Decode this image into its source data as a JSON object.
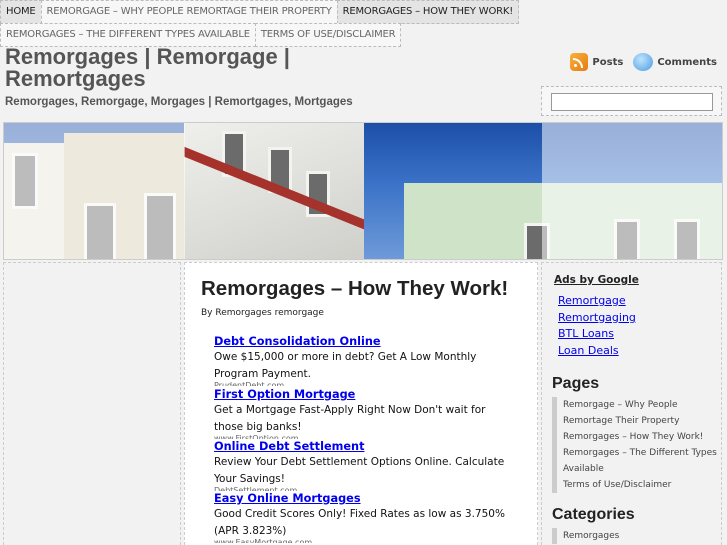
{
  "nav": {
    "row1": [
      "HOME",
      "REMORGAGE – WHY PEOPLE REMORTAGE THEIR PROPERTY",
      "REMORGAGES – HOW THEY WORK!"
    ],
    "row2": [
      "REMORGAGES – THE DIFFERENT TYPES AVAILABLE",
      "TERMS OF USE/DISCLAIMER"
    ]
  },
  "header": {
    "title": "Remorgages | Remorgage | Remortgages",
    "description": "Remorgages, Remorgage, Morgages | Remortgages, Mortgages",
    "posts_label": "Posts",
    "comments_label": "Comments"
  },
  "colors": {
    "link": "#0000ee",
    "rss": "#f08a1c",
    "sky": "#2e63b8"
  },
  "post": {
    "title": "Remorgages – How They Work!",
    "byline": "By Remorgages remorgage",
    "ads": [
      {
        "title": "Debt Consolidation Online",
        "desc": "Owe $15,000 or more in debt? Get A Low Monthly Program Payment.",
        "url": "PrudentDebt.com"
      },
      {
        "title": "First Option Mortgage",
        "desc": "Get a Mortgage Fast-Apply Right Now Don't wait for those big banks!",
        "url": "www.FirstOption.com"
      },
      {
        "title": "Online Debt Settlement",
        "desc": "Review Your Debt Settlement Options Online. Calculate Your Savings!",
        "url": "DebtSettlement.com"
      },
      {
        "title": "Easy Online Mortgages",
        "desc": "Good Credit Scores Only! Fixed Rates as low as 3.750% (APR 3.823%)",
        "url": "www.EasyMortgage.com"
      }
    ]
  },
  "sidebar": {
    "ads_by_google": "Ads by Google",
    "ad_links": [
      "Remortgage",
      "Remortgaging",
      "BTL Loans",
      "Loan Deals"
    ],
    "pages_title": "Pages",
    "pages": [
      "Remorgage – Why People Remortage Their Property",
      "Remorgages – How They Work!",
      "Remorgages – The Different Types Available",
      "Terms of Use/Disclaimer"
    ],
    "categories_title": "Categories",
    "categories": [
      "Remorgages"
    ]
  }
}
